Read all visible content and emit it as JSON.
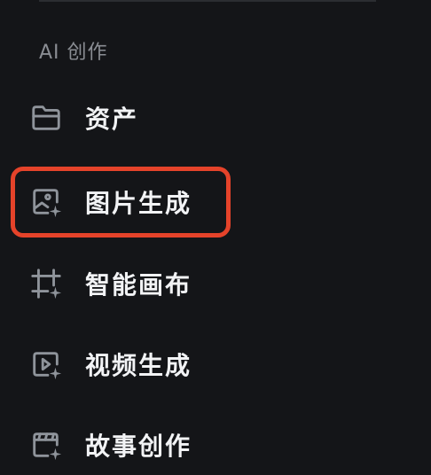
{
  "sidebar": {
    "section_label": "AI 创作",
    "items": [
      {
        "label": "资产",
        "icon": "folder-icon"
      },
      {
        "label": "图片生成",
        "icon": "image-sparkle-icon"
      },
      {
        "label": "智能画布",
        "icon": "canvas-crop-sparkle-icon"
      },
      {
        "label": "视频生成",
        "icon": "video-sparkle-icon"
      },
      {
        "label": "故事创作",
        "icon": "storyboard-sparkle-icon"
      }
    ]
  },
  "colors": {
    "background": "#141518",
    "text": "#f2f3f5",
    "section_label": "#8a8d93",
    "icon": "#8f949b",
    "highlight": "#e5432a"
  }
}
